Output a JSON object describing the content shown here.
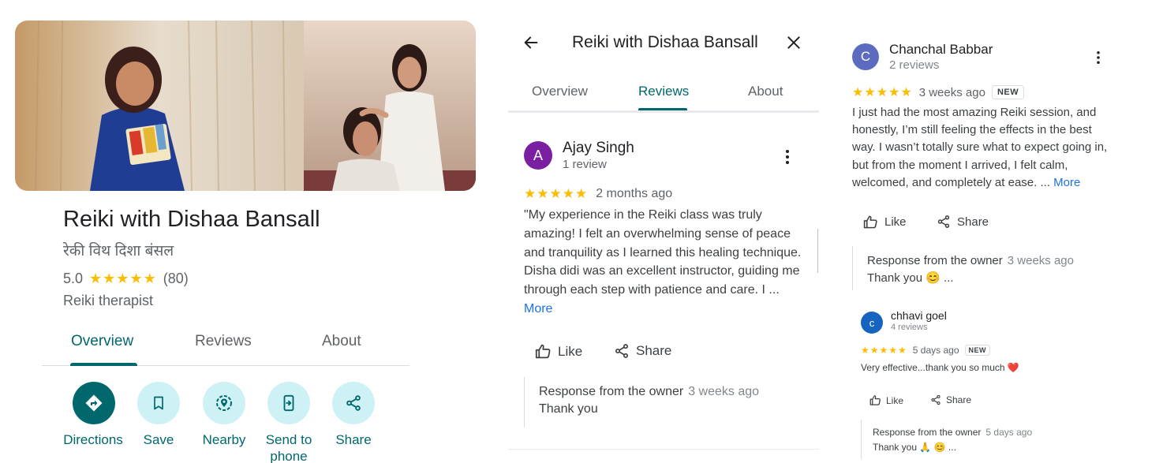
{
  "listing": {
    "name": "Reiki with Dishaa Bansall",
    "name_local": "रेकी विथ दिशा बंसल",
    "rating": "5.0",
    "stars": "★★★★★",
    "review_count": "(80)",
    "category": "Reiki therapist",
    "tabs": [
      "Overview",
      "Reviews",
      "About"
    ],
    "actions": [
      {
        "label": "Directions",
        "icon": "directions-icon"
      },
      {
        "label": "Save",
        "icon": "bookmark-icon"
      },
      {
        "label": "Nearby",
        "icon": "nearby-icon"
      },
      {
        "label": "Send to phone",
        "icon": "send-to-phone-icon"
      },
      {
        "label": "Share",
        "icon": "share-icon"
      }
    ],
    "accent_color": "#00676d"
  },
  "reviews_panel": {
    "title": "Reiki with Dishaa Bansall",
    "tabs": [
      "Overview",
      "Reviews",
      "About"
    ],
    "active_tab": "Reviews"
  },
  "review1": {
    "avatar_letter": "A",
    "avatar_color": "#7b1fa2",
    "author": "Ajay Singh",
    "count": "1 review",
    "stars": "★★★★★",
    "time": "2 months ago",
    "text": "\"My experience in the Reiki class was truly amazing! I felt an overwhelming sense of peace and tranquility as I learned this healing technique. Disha didi was an excellent instructor, guiding me through each step with patience and care. I ...",
    "more": "More",
    "like": "Like",
    "share": "Share",
    "response_title": "Response from the owner",
    "response_time": "3 weeks ago",
    "response_text": "Thank you"
  },
  "review2": {
    "avatar_letter": "C",
    "avatar_color": "#5c6bc0",
    "author": "Chanchal Babbar",
    "count": "2 reviews",
    "stars": "★★★★★",
    "time": "3 weeks ago",
    "badge": "NEW",
    "text": "I just had the most amazing Reiki session, and honestly, I’m still feeling the effects in the best way. I wasn’t totally sure what to expect going in, but from the moment I arrived, I felt calm, welcomed, and completely at ease. ...",
    "more": "More",
    "like": "Like",
    "share": "Share",
    "response_title": "Response from the owner",
    "response_time": "3 weeks ago",
    "response_text": "Thank you 😊 ..."
  },
  "review3": {
    "avatar_letter": "c",
    "avatar_color": "#1565c0",
    "author": "chhavi goel",
    "count": "4 reviews",
    "stars": "★★★★★",
    "time": "5 days ago",
    "badge": "NEW",
    "text": "Very effective...thank you so much ❤️",
    "like": "Like",
    "share": "Share",
    "response_title": "Response from the owner",
    "response_time": "5 days ago",
    "response_text": "Thank you 🙏 😊 ..."
  }
}
